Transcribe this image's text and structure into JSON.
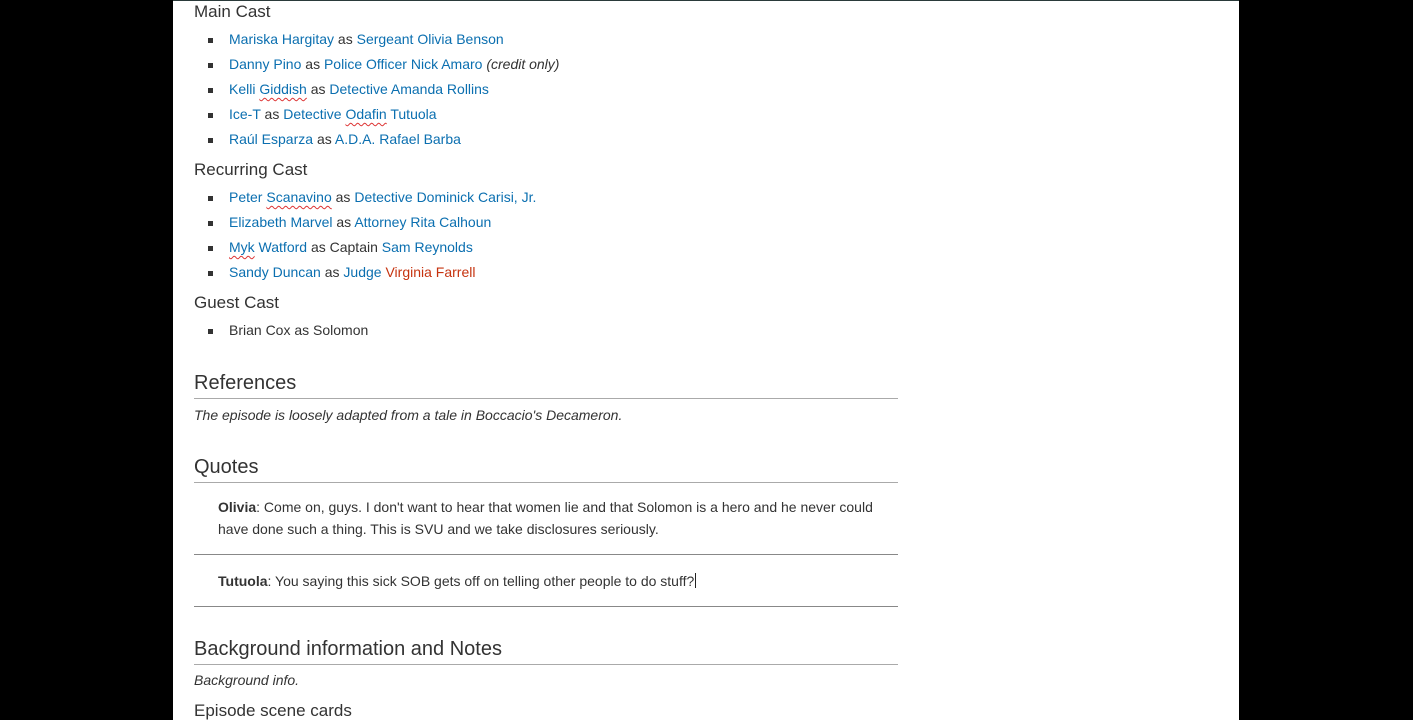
{
  "main_cast": {
    "heading": "Main Cast",
    "items": [
      {
        "actor": "Mariska Hargitay",
        "as": "as",
        "role": "Sergeant Olivia Benson",
        "extra": ""
      },
      {
        "actor": "Danny Pino",
        "as": "as",
        "role": "Police Officer Nick Amaro",
        "extra": "(credit only)"
      },
      {
        "actor_a": "Kelli ",
        "actor_b": "Giddish",
        "as": "as",
        "role": "Detective Amanda Rollins"
      },
      {
        "actor": "Ice-T",
        "as": "as",
        "role_a": "Detective ",
        "role_b": "Odafin",
        "role_c": " Tutuola"
      },
      {
        "actor": "Raúl Esparza",
        "as": "as",
        "role": "A.D.A. Rafael Barba"
      }
    ]
  },
  "recurring_cast": {
    "heading": "Recurring Cast",
    "items": [
      {
        "actor_a": "Peter ",
        "actor_b": "Scanavino",
        "as": "as",
        "role": "Detective Dominick Carisi, Jr."
      },
      {
        "actor": "Elizabeth Marvel",
        "as": "as",
        "role": "Attorney Rita Calhoun"
      },
      {
        "actor_a": "Myk",
        "actor_b": " Watford",
        "as": "as Captain",
        "role": "Sam Reynolds"
      },
      {
        "actor": "Sandy Duncan",
        "as": "as",
        "role_a": "Judge",
        "role_b": "Virginia Farrell"
      }
    ]
  },
  "guest_cast": {
    "heading": "Guest Cast",
    "items": [
      {
        "text": "Brian Cox as Solomon"
      }
    ]
  },
  "references": {
    "heading": "References",
    "text": "The episode is loosely adapted from a tale in Boccacio's Decameron."
  },
  "quotes": {
    "heading": "Quotes",
    "items": [
      {
        "speaker": "Olivia",
        "text": ": Come on, guys. I don't want to hear that women lie and that Solomon is a hero and he never could have done such a thing. This is SVU and we take disclosures seriously."
      },
      {
        "speaker": "Tutuola",
        "text": ": You saying this sick SOB gets off on telling other people to do stuff?"
      }
    ]
  },
  "background": {
    "heading": "Background information and Notes",
    "text": "Background info."
  },
  "scene_cards": {
    "heading": "Episode scene cards"
  },
  "colors": {
    "link": "#0b6fb0",
    "redlink": "#c6330f",
    "text": "#333333"
  }
}
